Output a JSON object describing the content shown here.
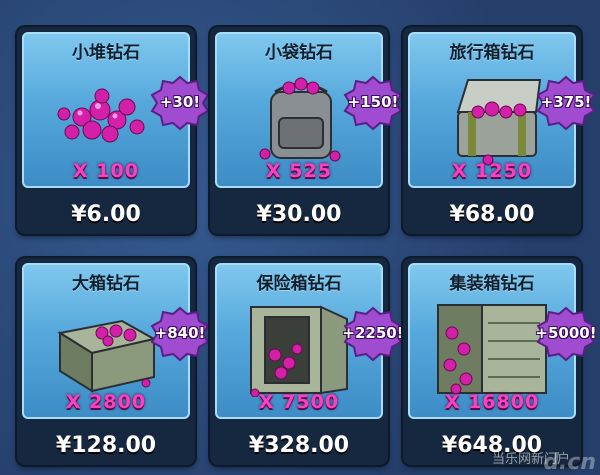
{
  "shop": {
    "items": [
      {
        "name": "小堆钻石",
        "qty": "X 100",
        "price": "¥6.00",
        "bonus": "+30!",
        "icon": "gem-pile-icon"
      },
      {
        "name": "小袋钻石",
        "qty": "X 525",
        "price": "¥30.00",
        "bonus": "+150!",
        "icon": "backpack-icon"
      },
      {
        "name": "旅行箱钻石",
        "qty": "X 1250",
        "price": "¥68.00",
        "bonus": "+375!",
        "icon": "suitcase-icon"
      },
      {
        "name": "大箱钻石",
        "qty": "X 2800",
        "price": "¥128.00",
        "bonus": "+840!",
        "icon": "crate-icon"
      },
      {
        "name": "保险箱钻石",
        "qty": "X 7500",
        "price": "¥328.00",
        "bonus": "+2250!",
        "icon": "safe-icon"
      },
      {
        "name": "集装箱钻石",
        "qty": "X 16800",
        "price": "¥648.00",
        "bonus": "+5000!",
        "icon": "container-icon"
      }
    ]
  },
  "watermark": {
    "text": "当乐网新门户",
    "logo": "d.cn"
  },
  "colors": {
    "panel": "#56a8dc",
    "qty": "#ff3ec4",
    "bonus": "#a04cd0",
    "frame": "#16283f"
  }
}
